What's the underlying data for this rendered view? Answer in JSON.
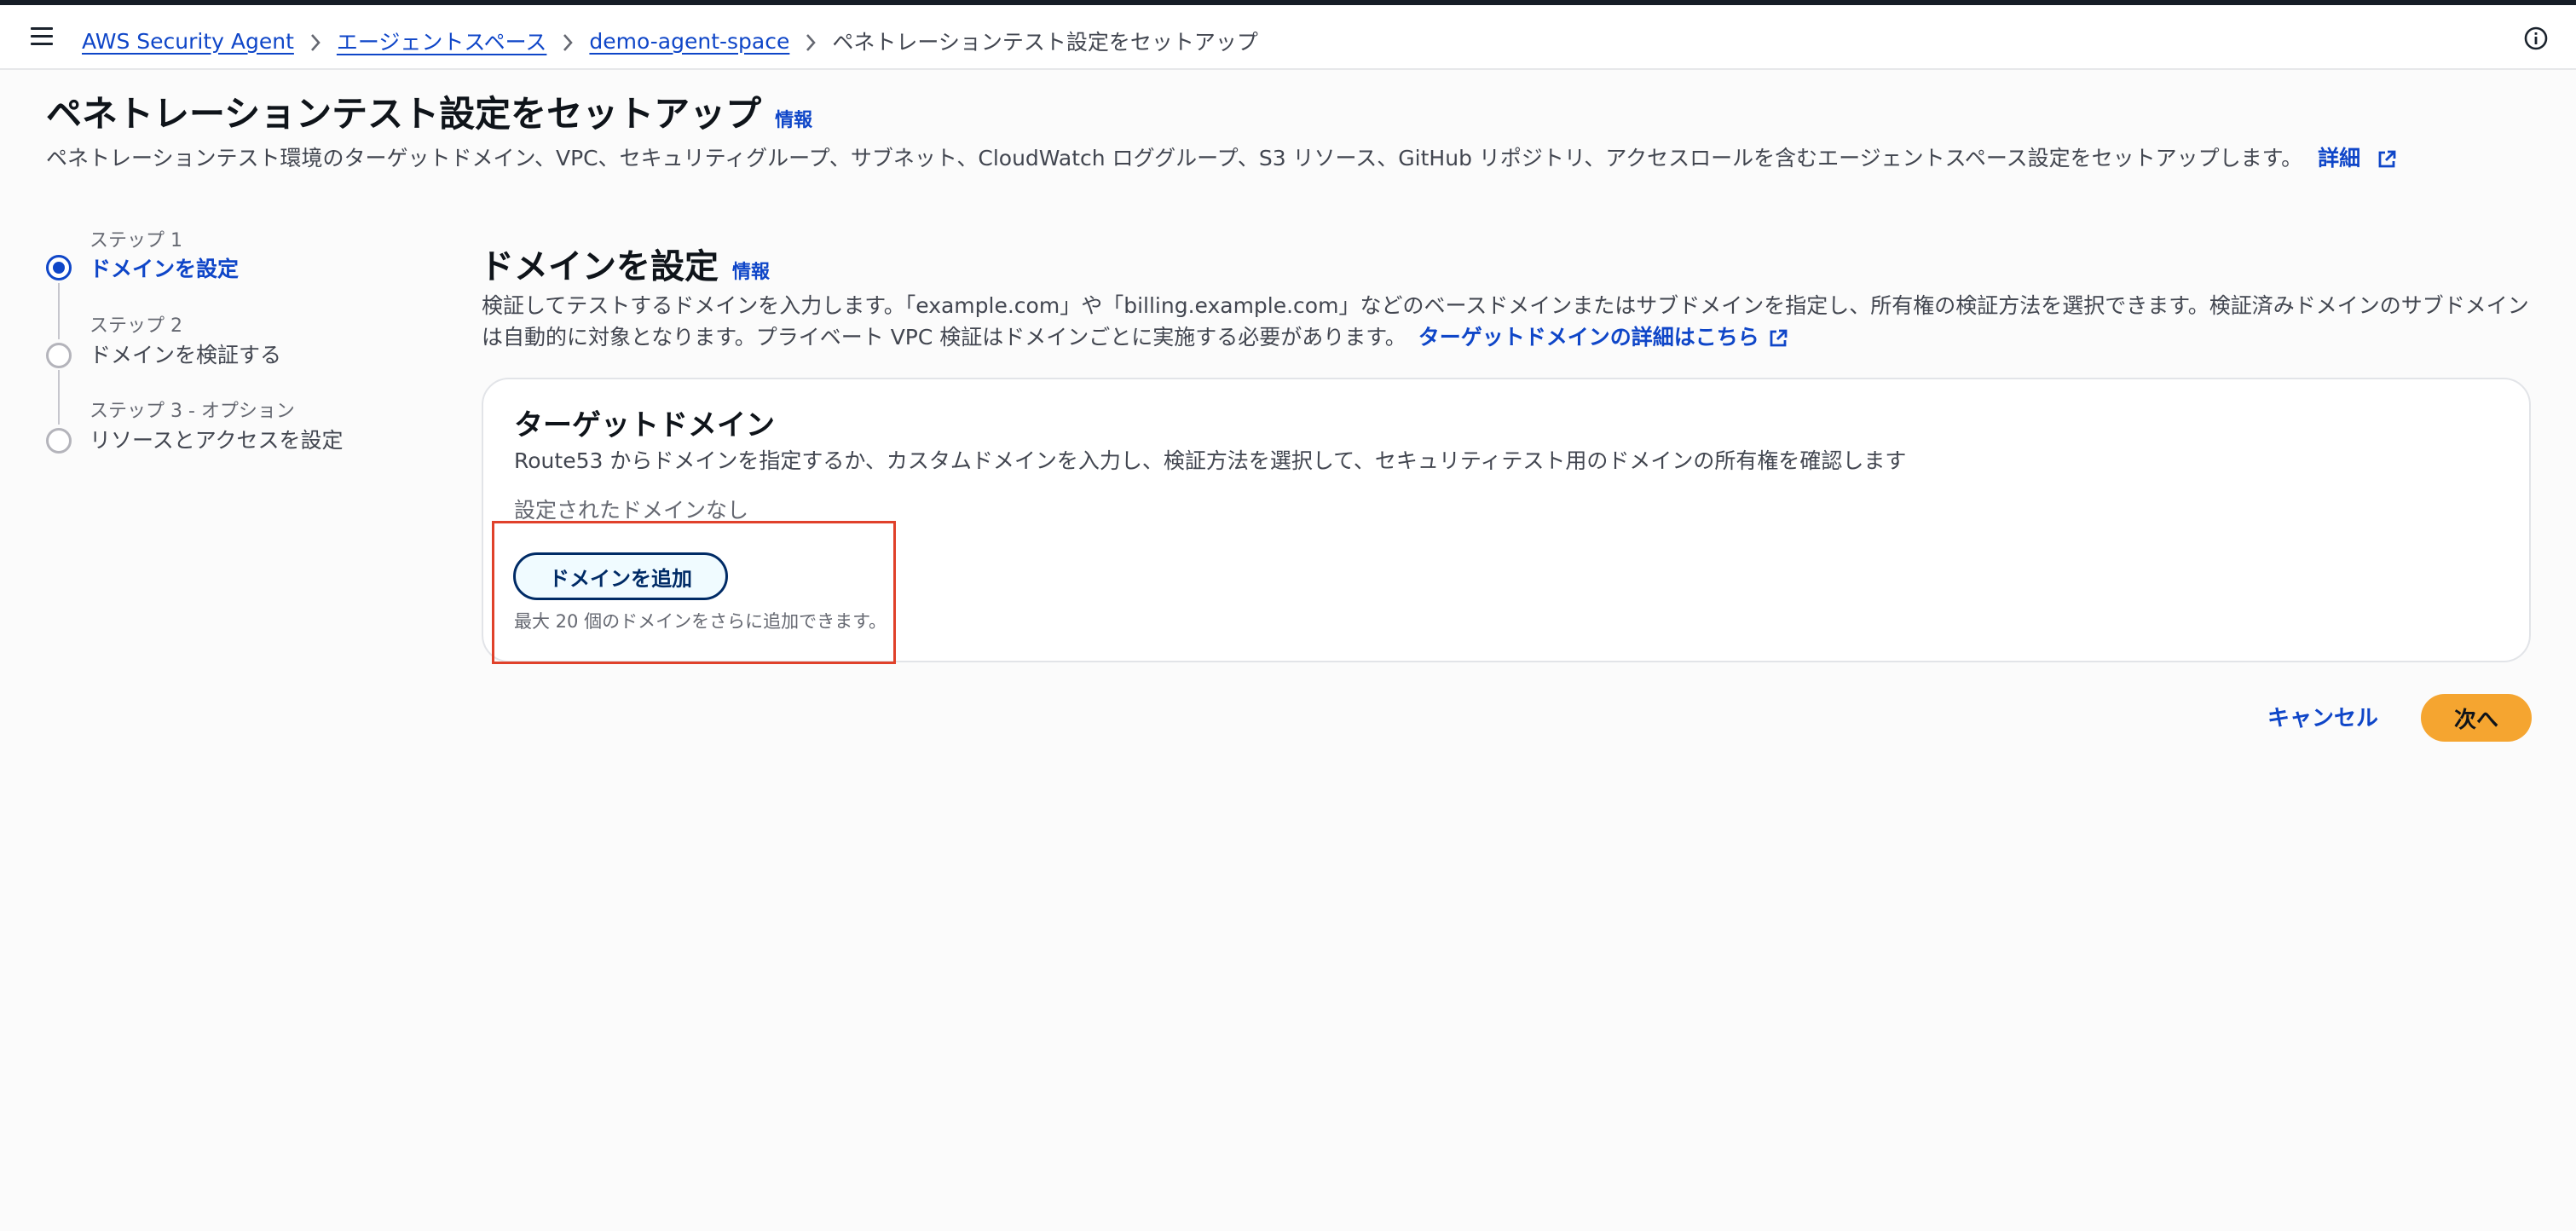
{
  "header": {
    "breadcrumb": [
      {
        "label": "AWS Security Agent"
      },
      {
        "label": "エージェントスペース"
      },
      {
        "label": "demo-agent-space"
      }
    ],
    "current": "ペネトレーションテスト設定をセットアップ"
  },
  "page": {
    "title": "ペネトレーションテスト設定をセットアップ",
    "info": "情報",
    "description": "ペネトレーションテスト環境のターゲットドメイン、VPC、セキュリティグループ、サブネット、CloudWatch ロググループ、S3 リソース、GitHub リポジトリ、アクセスロールを含むエージェントスペース設定をセットアップします。",
    "details_link": "詳細"
  },
  "steps": [
    {
      "number": "ステップ 1",
      "title": "ドメインを設定",
      "state": "active"
    },
    {
      "number": "ステップ 2",
      "title": "ドメインを検証する",
      "state": "pending"
    },
    {
      "number": "ステップ 3 - オプション",
      "title": "リソースとアクセスを設定",
      "state": "pending"
    }
  ],
  "section": {
    "title": "ドメインを設定",
    "info": "情報",
    "description": "検証してテストするドメインを入力します。「example.com」や「billing.example.com」などのベースドメインまたはサブドメインを指定し、所有権の検証方法を選択できます。検証済みドメインのサブドメインは自動的に対象となります。プライベート VPC 検証はドメインごとに実施する必要があります。",
    "link": "ターゲットドメインの詳細はこちら"
  },
  "card": {
    "title": "ターゲットドメイン",
    "description": "Route53 からドメインを指定するか、カスタムドメインを入力し、検証方法を選択して、セキュリティテスト用のドメインの所有権を確認します",
    "empty": "設定されたドメインなし",
    "add_button": "ドメインを追加",
    "hint": "最大 20 個のドメインをさらに追加できます。"
  },
  "footer": {
    "cancel": "キャンセル",
    "next": "次へ"
  },
  "colors": {
    "accent": "#0f46c8",
    "primary_button": "#f5a530",
    "highlight": "#e0412a"
  }
}
